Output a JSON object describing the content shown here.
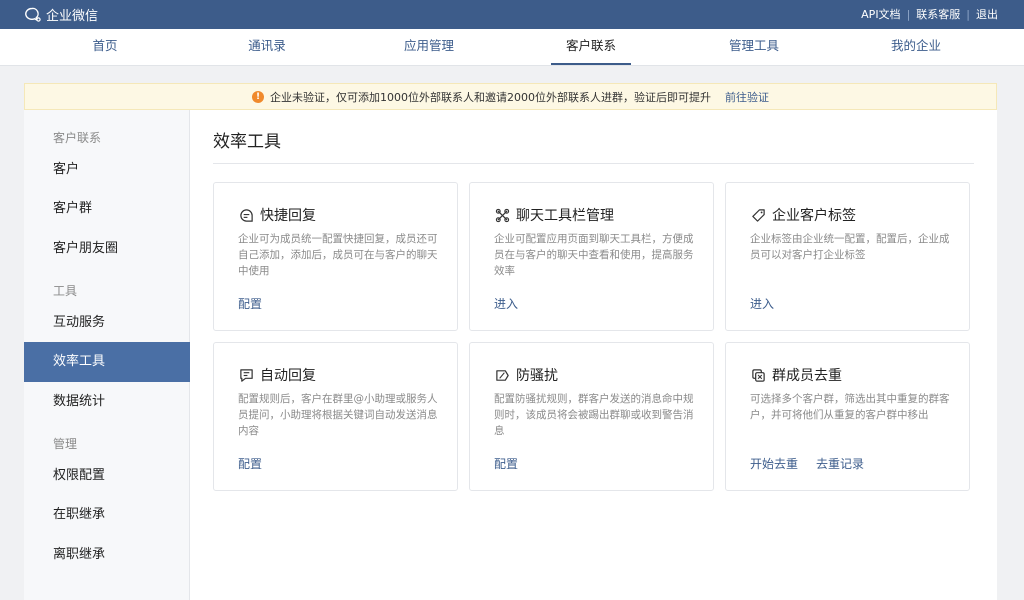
{
  "app": {
    "title": "企业微信"
  },
  "toplinks": [
    "API文档",
    "联系客服",
    "退出"
  ],
  "nav": [
    "首页",
    "通讯录",
    "应用管理",
    "客户联系",
    "管理工具",
    "我的企业"
  ],
  "notice": {
    "text": "企业未验证，仅可添加1000位外部联系人和邀请2000位外部联系人进群，验证后即可提升",
    "link": "前往验证"
  },
  "sidebar": {
    "groups": [
      "客户联系",
      "工具",
      "管理"
    ],
    "items": [
      "客户",
      "客户群",
      "客户朋友圈",
      "互动服务",
      "效率工具",
      "数据统计",
      "权限配置",
      "在职继承",
      "离职继承"
    ]
  },
  "main": {
    "title": "效率工具"
  },
  "cards": [
    {
      "title": "快捷回复",
      "icon": "chat-lines-icon",
      "desc": "企业可为成员统一配置快捷回复，成员还可自己添加，添加后，成员可在与客户的聊天中使用",
      "actions": [
        "配置"
      ]
    },
    {
      "title": "聊天工具栏管理",
      "icon": "tools-icon",
      "desc": "企业可配置应用页面到聊天工具栏，方便成员在与客户的聊天中查看和使用，提高服务效率",
      "actions": [
        "进入"
      ]
    },
    {
      "title": "企业客户标签",
      "icon": "tag-icon",
      "desc": "企业标签由企业统一配置，配置后，企业成员可以对客户打企业标签",
      "actions": [
        "进入"
      ]
    },
    {
      "title": "自动回复",
      "icon": "auto-reply-icon",
      "desc": "配置规则后，客户在群里@小助理或服务人员提问，小助理将根据关键词自动发送消息内容",
      "actions": [
        "配置"
      ]
    },
    {
      "title": "防骚扰",
      "icon": "flag-icon",
      "desc": "配置防骚扰规则，群客户发送的消息命中规则时，该成员将会被踢出群聊或收到警告消息",
      "actions": [
        "配置"
      ]
    },
    {
      "title": "群成员去重",
      "icon": "dedupe-icon",
      "desc": "可选择多个客户群，筛选出其中重复的群客户，并可将他们从重复的客户群中移出",
      "actions": [
        "开始去重",
        "去重记录"
      ]
    }
  ],
  "colors": {
    "topbar": "#3d5c8a",
    "accent": "#4a6fa5",
    "link": "#3d5d8c",
    "notice_bg": "#fdf8e4",
    "warn": "#f08a2c"
  }
}
